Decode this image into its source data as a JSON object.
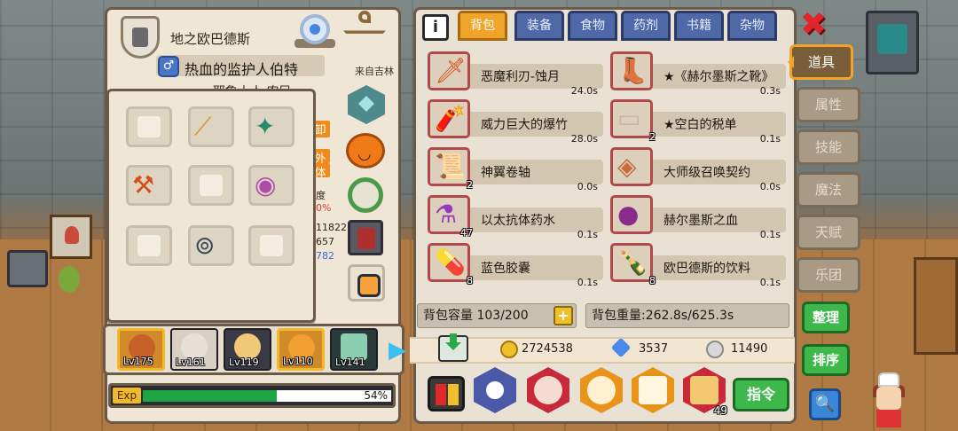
{
  "hero": {
    "title": "地之欧巴德斯",
    "name": "热血的监护人伯特",
    "gender_symbol": "♂",
    "from": "来自吉林",
    "subtitle": "耶鲁大人 农民",
    "stat_tags": [
      "卸",
      "外",
      "体"
    ],
    "stat_lines": [
      "度",
      "0%",
      "11822",
      "657",
      "782"
    ],
    "exp_label": "Exp",
    "exp_percent": 54,
    "exp_percent_text": "54%"
  },
  "party": [
    {
      "level": "Lv175",
      "color": "#d9842a"
    },
    {
      "level": "Lv161",
      "color": "#e6e0d6"
    },
    {
      "level": "Lv119",
      "color": "#f0c878"
    },
    {
      "level": "Lv110",
      "color": "#f0a030"
    },
    {
      "level": "Lv141",
      "color": "#2a3a3a"
    }
  ],
  "equipment": [
    {
      "slot": "empty",
      "icon": "empty-slot-icon"
    },
    {
      "slot": "staff",
      "icon": "golden-staff-icon",
      "glyph": "⟋"
    },
    {
      "slot": "bow",
      "icon": "green-crossbow-icon",
      "glyph": "✦"
    },
    {
      "slot": "axe",
      "icon": "flame-axe-icon",
      "glyph": "⚒"
    },
    {
      "slot": "empty",
      "icon": "empty-slot-icon"
    },
    {
      "slot": "lock",
      "icon": "purple-lock-icon",
      "glyph": "◉"
    },
    {
      "slot": "empty",
      "icon": "empty-slot-icon"
    },
    {
      "slot": "necklace",
      "icon": "dark-necklace-icon",
      "glyph": "⊚"
    },
    {
      "slot": "empty",
      "icon": "empty-slot-icon"
    }
  ],
  "tabs": {
    "info": "i",
    "items": [
      "背包",
      "装备",
      "食物",
      "药剂",
      "书籍",
      "杂物"
    ],
    "active": "背包"
  },
  "items": [
    {
      "name": "恶魔利刃-蚀月",
      "weight": "24.0s",
      "count": "",
      "glyph": "🗡",
      "color": "#d4501a"
    },
    {
      "name": "★《赫尔墨斯之靴》",
      "weight": "0.3s",
      "count": "",
      "glyph": "👢",
      "color": "#e0a020"
    },
    {
      "name": "威力巨大的爆竹",
      "weight": "28.0s",
      "count": "",
      "glyph": "🧨",
      "color": "#d02a2a"
    },
    {
      "name": "★空白的税单",
      "weight": "0.1s",
      "count": "2",
      "glyph": "▭",
      "color": "#c8b8a0"
    },
    {
      "name": "神翼卷轴",
      "weight": "0.0s",
      "count": "2",
      "glyph": "📜",
      "color": "#7a4ac8"
    },
    {
      "name": "大师级召唤契约",
      "weight": "0.0s",
      "count": "",
      "glyph": "◈",
      "color": "#c86a3a"
    },
    {
      "name": "以太抗体药水",
      "weight": "0.1s",
      "count": "47",
      "glyph": "⚗",
      "color": "#9a3ab8"
    },
    {
      "name": "赫尔墨斯之血",
      "weight": "0.1s",
      "count": "",
      "glyph": "●",
      "color": "#8a2a8a"
    },
    {
      "name": "蓝色胶囊",
      "weight": "0.1s",
      "count": "8",
      "glyph": "💊",
      "color": "#3a6ad8"
    },
    {
      "name": "欧巴德斯的饮料",
      "weight": "0.1s",
      "count": "8",
      "glyph": "🍾",
      "color": "#6a1a1a"
    }
  ],
  "bag": {
    "capacity": "背包容量 103/200",
    "plus": "+",
    "weight": "背包重量:262.8s/625.3s"
  },
  "currency": {
    "gold": "2724538",
    "gems": "3537",
    "silver": "11490"
  },
  "actions": {
    "command": "指令",
    "badge_count": "49"
  },
  "side": {
    "close": "✖",
    "tabs": [
      "道具",
      "属性",
      "技能",
      "魔法",
      "天赋",
      "乐团"
    ],
    "active": "道具",
    "sort_label": "整理",
    "order_label": "排序",
    "search": "🔍"
  },
  "colors": {
    "accent_orange": "#f0a42a",
    "tab_blue": "#4f68a8",
    "green_button": "#3eb84a",
    "exp_green": "#1ea644",
    "close_red": "#e0262a"
  }
}
